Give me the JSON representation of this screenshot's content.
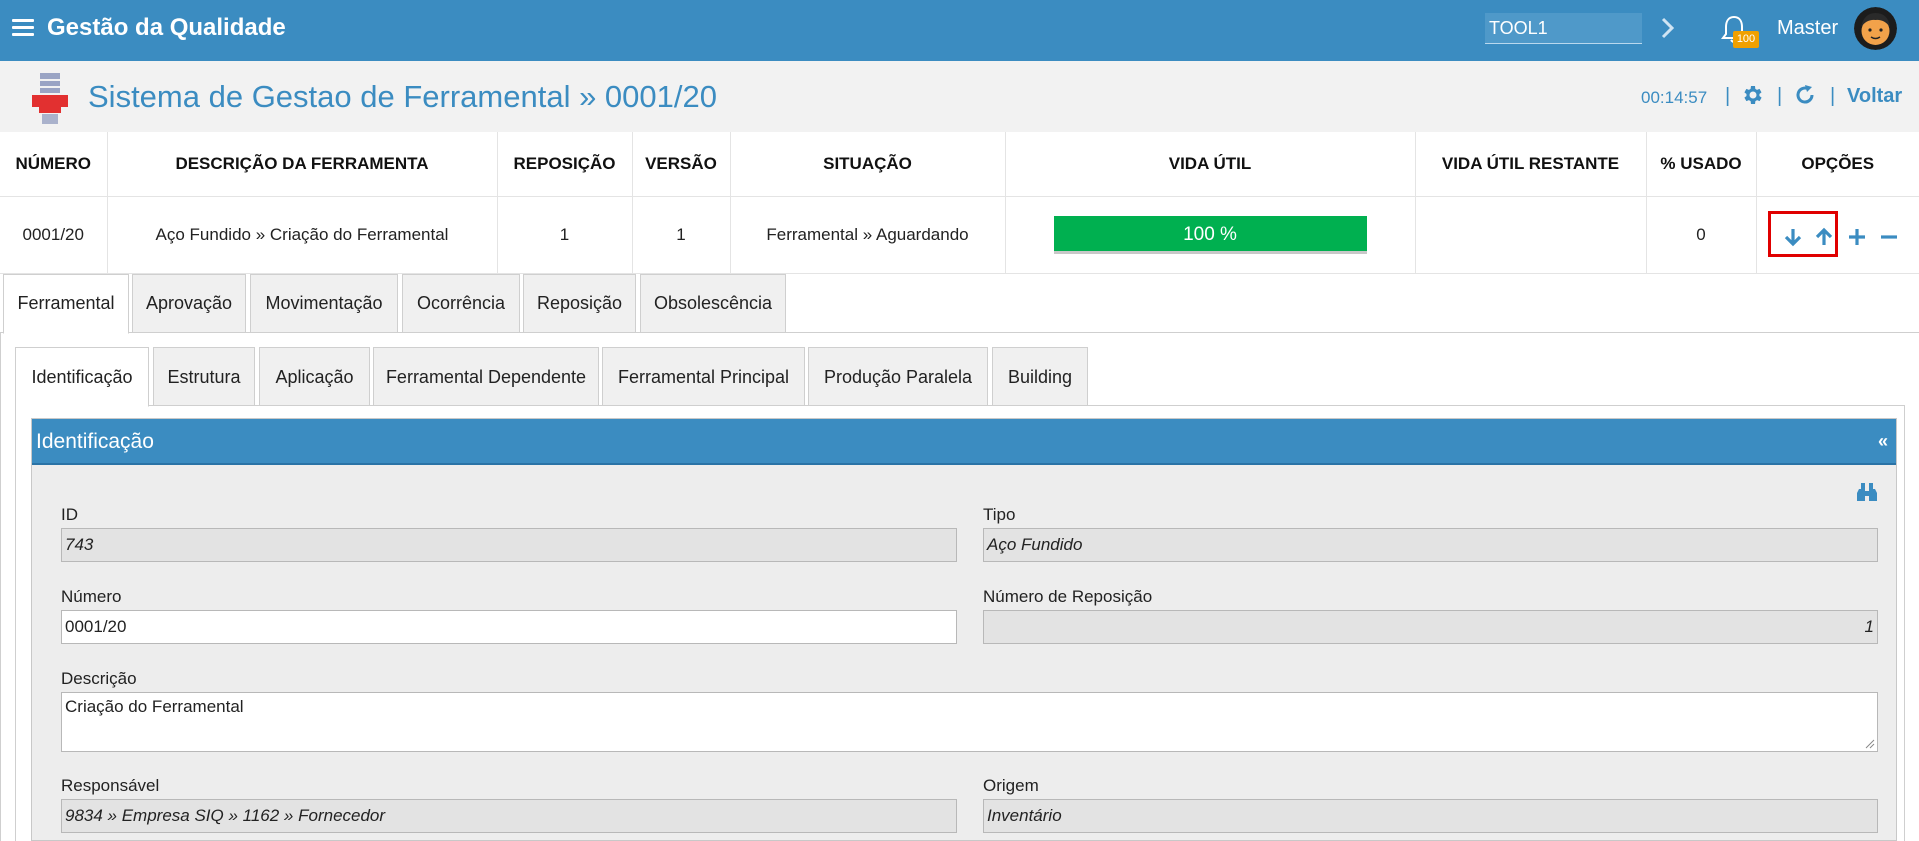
{
  "topbar": {
    "app_title": "Gestão da Qualidade",
    "search_value": "TOOL1",
    "notification_count": "100",
    "user_name": "Master"
  },
  "header": {
    "title": "Sistema de Gestao de Ferramental » 0001/20",
    "clock": "00:14:57",
    "back_label": "Voltar"
  },
  "summary": {
    "columns": [
      "Número",
      "Descrição da Ferramenta",
      "Reposição",
      "Versão",
      "Situação",
      "Vida Útil",
      "Vida Útil Restante",
      "% Usado",
      "Opções"
    ],
    "row": {
      "numero": "0001/20",
      "descricao": "Aço Fundido » Criação do Ferramental",
      "reposicao": "1",
      "versao": "1",
      "situacao": "Ferramental » Aguardando",
      "vida_util_label": "100 %",
      "vida_util_percent": 100,
      "vida_util_restante": "",
      "usado": "0"
    }
  },
  "tabs_main": [
    "Ferramental",
    "Aprovação",
    "Movimentação",
    "Ocorrência",
    "Reposição",
    "Obsolescência"
  ],
  "tabs_sub": [
    "Identificação",
    "Estrutura",
    "Aplicação",
    "Ferramental Dependente",
    "Ferramental Principal",
    "Produção Paralela",
    "Building"
  ],
  "panel": {
    "title": "Identificação",
    "collapse_symbol": "«"
  },
  "form": {
    "id_label": "ID",
    "id_value": "743",
    "tipo_label": "Tipo",
    "tipo_value": "Aço Fundido",
    "numero_label": "Número",
    "numero_value": "0001/20",
    "num_reposicao_label": "Número de Reposição",
    "num_reposicao_value": "1",
    "descricao_label": "Descrição",
    "descricao_value": "Criação do Ferramental",
    "responsavel_label": "Responsável",
    "responsavel_value": "9834 » Empresa SIQ » 1162 » Fornecedor",
    "origem_label": "Origem",
    "origem_value": "Inventário"
  },
  "colors": {
    "primary": "#3b8cc1",
    "progress_green": "#00b050",
    "badge_orange": "#f0a000",
    "highlight_red": "#e00000"
  }
}
